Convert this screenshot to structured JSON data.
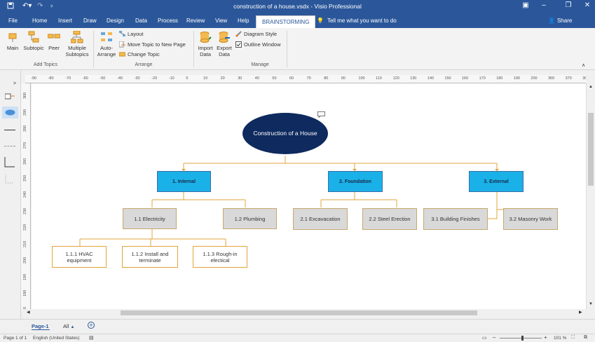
{
  "window": {
    "title": "construction of a house.vsdx  -  Visio Professional"
  },
  "colors": {
    "titlebar": "#2b579a",
    "root": "#0e2a5e",
    "level1": "#19b1e8",
    "level2": "#d9d9d9",
    "connector": "#e0a43c"
  },
  "tabs": [
    "File",
    "Home",
    "Insert",
    "Draw",
    "Design",
    "Data",
    "Process",
    "Review",
    "View",
    "Help",
    "BRAINSTORMING"
  ],
  "tell_me": "Tell me what you want to do",
  "share": "Share",
  "ribbon": {
    "add_topics": {
      "main": "Main",
      "subtopic": "Subtopic",
      "peer": "Peer",
      "multiple1": "Multiple",
      "multiple2": "Subtopics",
      "group": "Add Topics"
    },
    "arrange": {
      "auto1": "Auto-",
      "auto2": "Arrange",
      "layout": "Layout",
      "move": "Move Topic to New Page",
      "change": "Change Topic",
      "group": "Arrange"
    },
    "manage": {
      "import1": "Import",
      "import2": "Data",
      "export1": "Export",
      "export2": "Data",
      "diagram_style": "Diagram Style",
      "outline": "Outline Window",
      "group": "Manage"
    }
  },
  "ruler": {
    "h": [
      "-90",
      "-80",
      "-70",
      "-60",
      "-50",
      "-40",
      "-30",
      "-20",
      "-10",
      "0",
      "10",
      "20",
      "30",
      "40",
      "50",
      "60",
      "70",
      "80",
      "90",
      "100",
      "110",
      "120",
      "130",
      "140",
      "150",
      "160",
      "170",
      "180",
      "190",
      "200",
      "360",
      "370",
      "380"
    ],
    "v": [
      "300",
      "290",
      "280",
      "270",
      "260",
      "250",
      "240",
      "230",
      "220",
      "210",
      "200",
      "190",
      "180",
      "170"
    ]
  },
  "diagram": {
    "root": "Construction of a House",
    "internal": "1. Internal",
    "foundation": "2. Foundation",
    "external": "3. External",
    "electricity": "1.1 Electricity",
    "plumbing": "1.2 Plumbing",
    "excavacation": "2.1 Excavacation",
    "steel": "2.2 Steel Erection",
    "finishes": "3.1 Building Finishes",
    "masonry": "3.2 Masonry Work",
    "hvac": "1.1.1 HVAC equipment",
    "install": "1.1.2 Install and terminate",
    "roughin": "1.1.3 Rough-in electical"
  },
  "pages": {
    "active": "Page-1",
    "all": "All"
  },
  "status": {
    "page": "Page 1 of 1",
    "language": "English (United States)",
    "zoom": "101 %"
  }
}
